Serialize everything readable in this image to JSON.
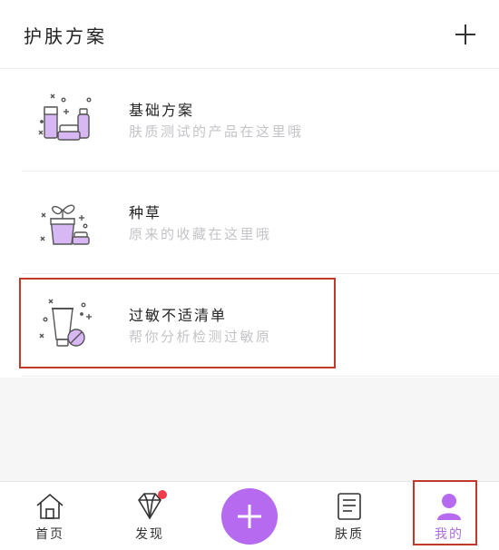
{
  "header": {
    "title": "护肤方案"
  },
  "plans": [
    {
      "title": "基础方案",
      "subtitle": "肤质测试的产品在这里哦",
      "icon": "skincare-products-icon"
    },
    {
      "title": "种草",
      "subtitle": "原来的收藏在这里哦",
      "icon": "plant-pot-icon"
    },
    {
      "title": "过敏不适清单",
      "subtitle": "帮你分析检测过敏原",
      "icon": "allergy-tube-icon"
    }
  ],
  "tabs": [
    {
      "label": "首页",
      "icon": "home-icon"
    },
    {
      "label": "发现",
      "icon": "diamond-icon"
    },
    {
      "label": "肤质",
      "icon": "notebook-icon"
    },
    {
      "label": "我的",
      "icon": "user-icon"
    }
  ],
  "colors": {
    "accent": "#b56af0",
    "accent_light": "#d7b8f5",
    "highlight": "#c0392b",
    "badge": "#f23c4a"
  }
}
